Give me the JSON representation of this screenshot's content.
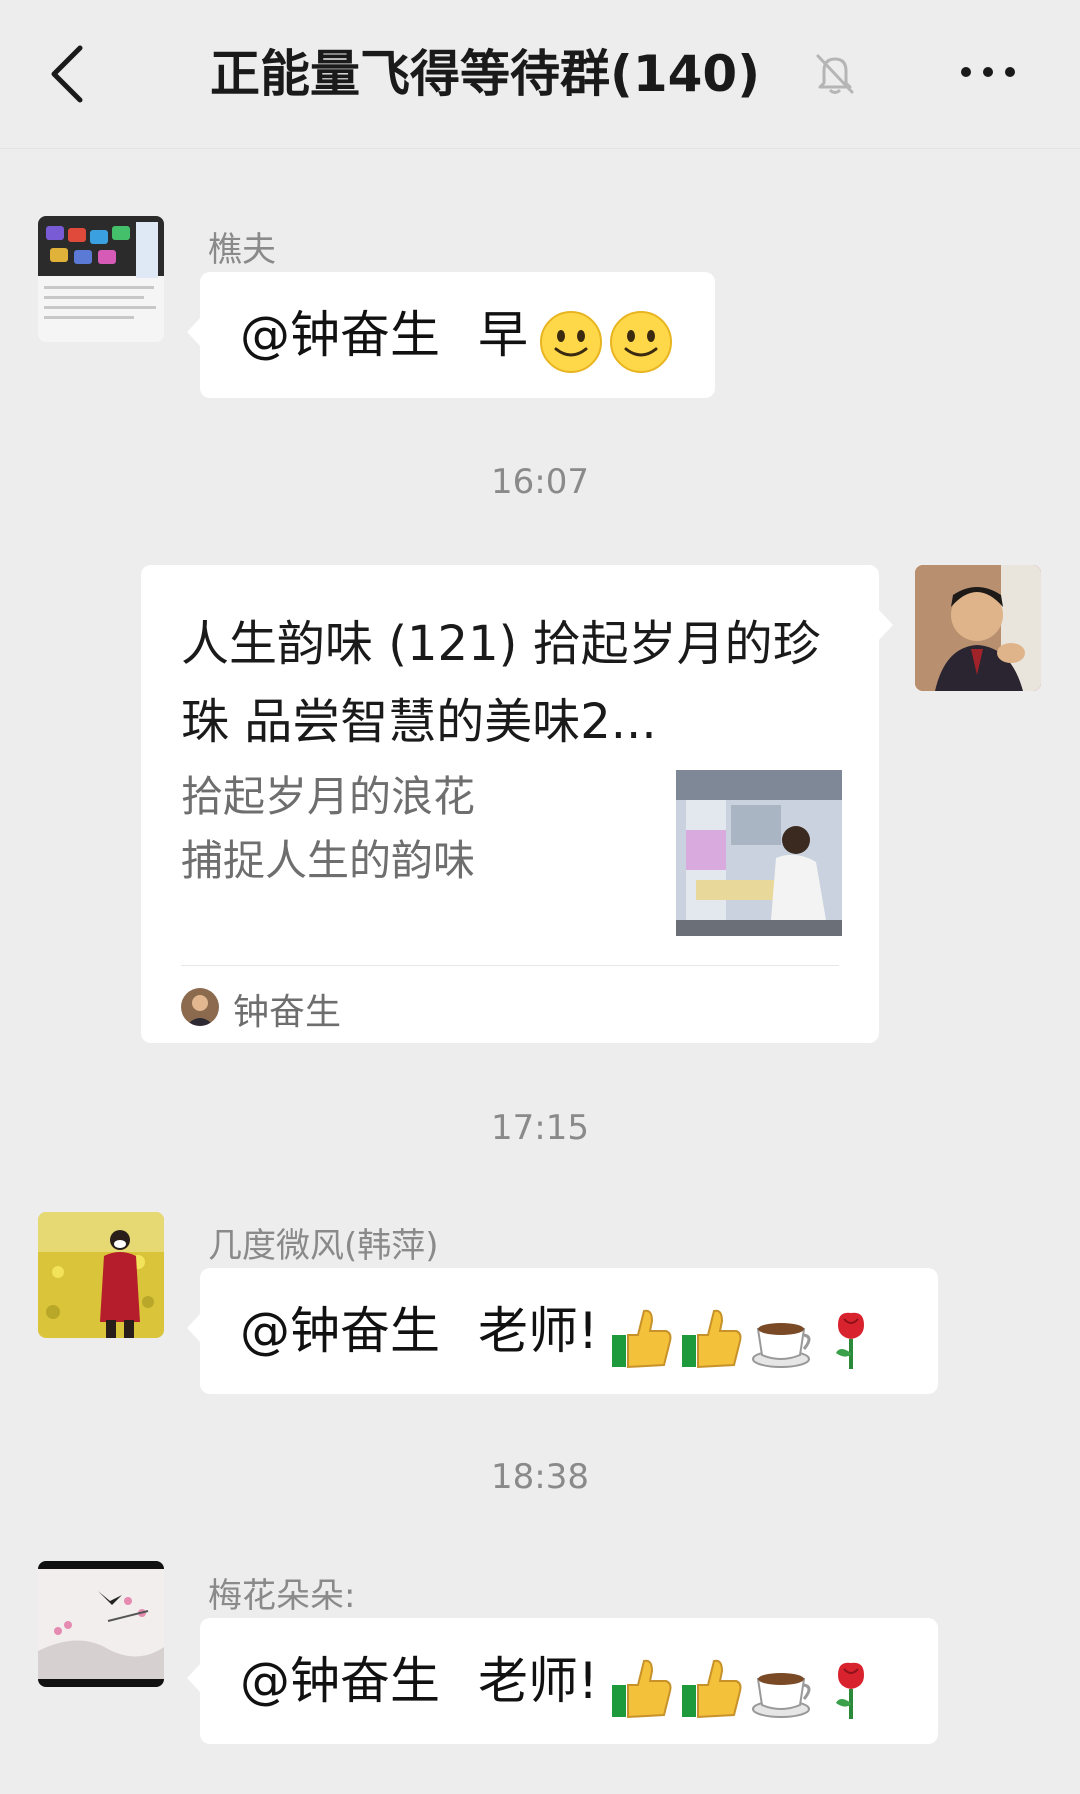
{
  "header": {
    "title": "正能量飞得等待群(140)",
    "back_icon": "chevron-left-icon",
    "mute_icon": "bell-muted-icon",
    "more_icon": "more-dots-icon"
  },
  "messages": [
    {
      "sender": "樵夫",
      "mention": "@钟奋生",
      "text": "早",
      "emojis": [
        "smile-emoji",
        "smile-emoji"
      ]
    },
    {
      "timestamp": "16:07"
    },
    {
      "type": "link_card",
      "card_title": "人生韵味 (121) 拾起岁月的珍珠 品尝智慧的美味2...",
      "card_desc_lines": [
        "拾起岁月的浪花",
        "捕捉人生的韵味"
      ],
      "card_source": "钟奋生"
    },
    {
      "timestamp": "17:15"
    },
    {
      "sender": "几度微风(韩萍)",
      "mention": "@钟奋生",
      "text": "老师!",
      "emojis": [
        "thumbs-up-emoji",
        "thumbs-up-emoji",
        "coffee-emoji",
        "rose-emoji"
      ]
    },
    {
      "timestamp": "18:38"
    },
    {
      "sender": "梅花朵朵:",
      "mention": "@钟奋生",
      "text": "老师!",
      "emojis": [
        "thumbs-up-emoji",
        "thumbs-up-emoji",
        "coffee-emoji",
        "rose-emoji"
      ]
    }
  ],
  "colors": {
    "background": "#ededed",
    "bubble": "#ffffff",
    "meta_text": "#8a8a8a"
  }
}
